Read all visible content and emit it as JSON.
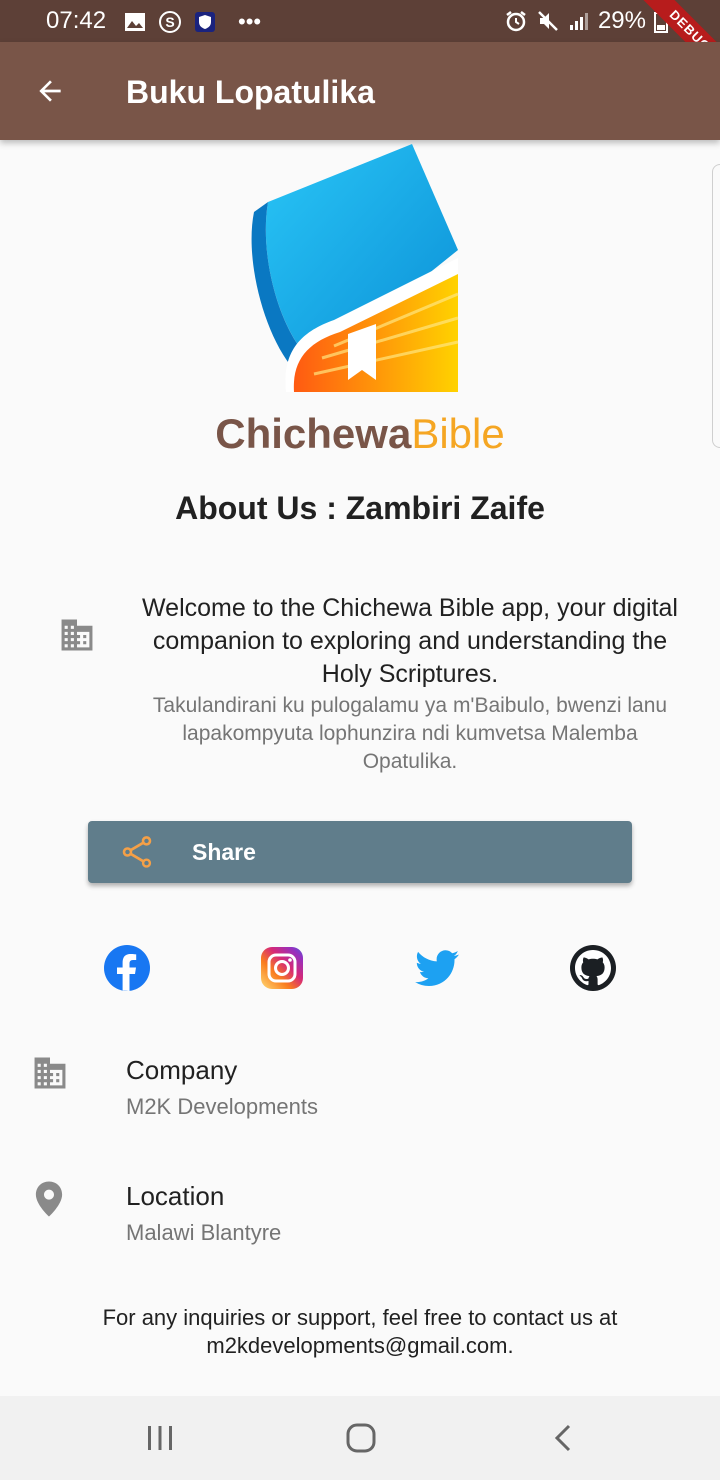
{
  "status_bar": {
    "time": "07:42",
    "battery": "29%",
    "debug_label": "DEBUG"
  },
  "app_bar": {
    "title": "Buku Lopatulika"
  },
  "logo": {
    "name_part1": "Chichewa",
    "name_part2": "Bible"
  },
  "about": {
    "title": "About Us : Zambiri Zaife",
    "welcome_en": "Welcome to the Chichewa Bible app, your digital companion to exploring and understanding the Holy Scriptures.",
    "welcome_ny": "Takulandirani ku pulogalamu ya m'Baibulo, bwenzi lanu lapakompyuta lophunzira ndi kumvetsa Malemba Opatulika."
  },
  "share": {
    "label": "Share"
  },
  "social": [
    "facebook-icon",
    "instagram-icon",
    "twitter-icon",
    "github-icon"
  ],
  "company": {
    "title": "Company",
    "value": "M2K Developments"
  },
  "location": {
    "title": "Location",
    "value": "Malawi Blantyre"
  },
  "contact": {
    "line1": "For any inquiries or support, feel free to contact us at",
    "line2": "m2kdevelopments@gmail.com."
  },
  "colors": {
    "status_bar": "#5d4037",
    "app_bar": "#795548",
    "share_button": "#607d8b",
    "share_icon": "#f5a047",
    "logo_accent": "#f5a623"
  }
}
